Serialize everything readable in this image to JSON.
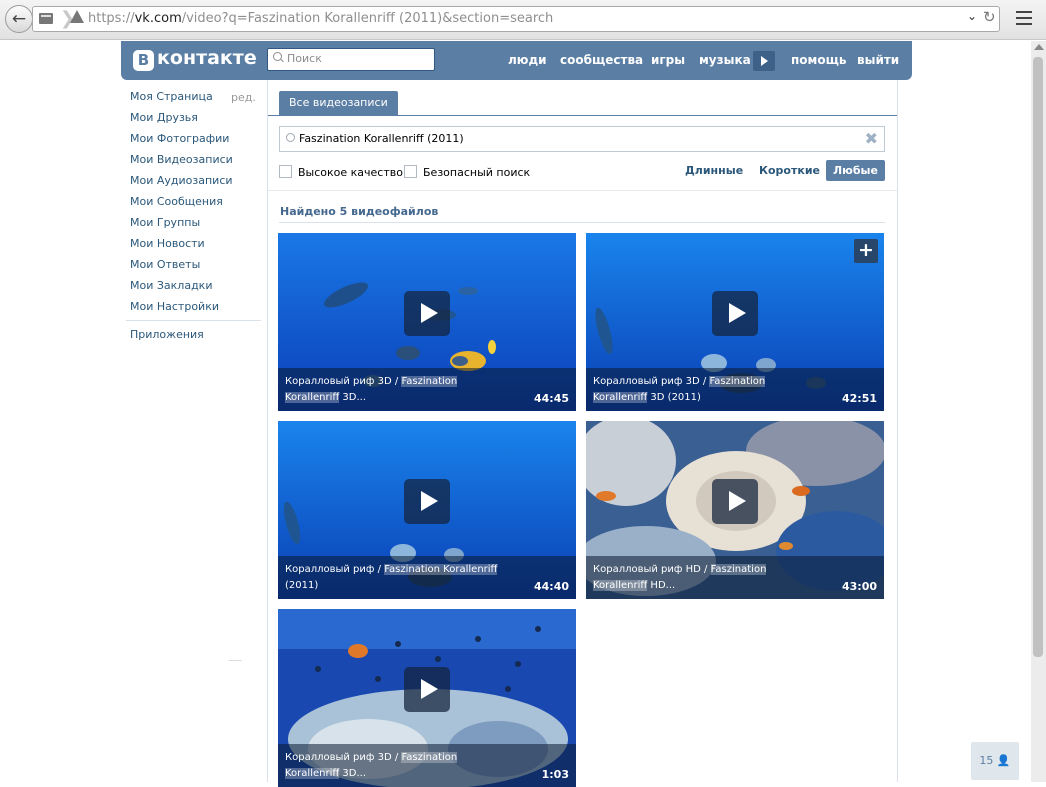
{
  "browser": {
    "url_prefix": "https://",
    "url_domain": "vk.com",
    "url_path": "/video?q=Faszination Korallenriff (2011)&section=search"
  },
  "header": {
    "logo_letter": "В",
    "logo_text": "контакте",
    "search_placeholder": "Поиск",
    "nav": [
      "люди",
      "сообщества",
      "игры",
      "музыка",
      "помощь",
      "выйти"
    ]
  },
  "sidebar": {
    "items": [
      "Моя Страница",
      "Мои Друзья",
      "Мои Фотографии",
      "Мои Видеозаписи",
      "Мои Аудиозаписи",
      "Мои Сообщения",
      "Мои Группы",
      "Мои Новости",
      "Мои Ответы",
      "Мои Закладки",
      "Мои Настройки"
    ],
    "edit_label": "ред.",
    "apps_label": "Приложения"
  },
  "content": {
    "tab_label": "Все видеозаписи",
    "search_value": "Faszination Korallenriff (2011)",
    "clear_icon": "close-icon",
    "checkboxes": [
      "Высокое качество",
      "Безопасный поиск"
    ],
    "filters": [
      "Длинные",
      "Короткие",
      "Любые"
    ],
    "active_filter": "Любые",
    "found_text": "Найдено 5 видеофайлов"
  },
  "videos": [
    {
      "title_pre": "Коралловый риф 3D / ",
      "title_hl": "Faszination Korallenriff",
      "title_post": " 3D...",
      "duration": "44:45"
    },
    {
      "title_pre": "Коралловый риф 3D / ",
      "title_hl": "Faszination Korallenriff",
      "title_post": " 3D (2011)",
      "duration": "42:51"
    },
    {
      "title_pre": "Коралловый риф / ",
      "title_hl": "Faszination Korallenriff",
      "title_post": " (2011)",
      "duration": "44:40"
    },
    {
      "title_pre": "Коралловый риф HD / ",
      "title_hl": "Faszination Korallenriff",
      "title_post": " HD...",
      "duration": "43:00"
    },
    {
      "title_pre": "Коралловый риф 3D / ",
      "title_hl": "Faszination Korallenriff",
      "title_post": " 3D...",
      "duration": "1:03"
    }
  ],
  "add_button_label": "+",
  "notifications": {
    "count": "15"
  },
  "colors": {
    "brand": "#5b7ea4",
    "link": "#2b587a",
    "water": "#1b5fd0"
  }
}
